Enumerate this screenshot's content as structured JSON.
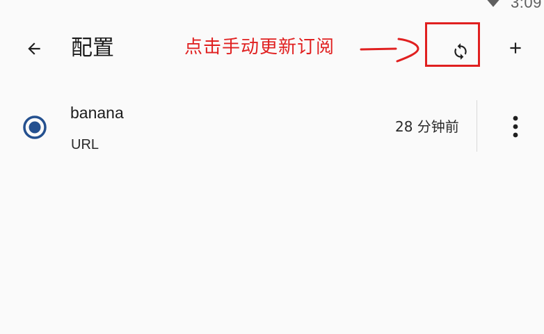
{
  "status_bar": {
    "time": "3:09",
    "icons": [
      "wifi-icon"
    ]
  },
  "app_bar": {
    "title": "配置",
    "back_icon": "arrow-back-icon",
    "refresh_icon": "sync-icon",
    "add_icon": "plus-icon"
  },
  "annotation": {
    "text": "点击手动更新订阅",
    "color": "#e02020"
  },
  "profiles": [
    {
      "name": "banana",
      "type": "URL",
      "updated": "28 分钟前",
      "selected": true,
      "menu_icon": "more-vertical-icon"
    }
  ],
  "colors": {
    "accent": "#24508f",
    "annotation": "#e02020",
    "background": "#fafafa"
  }
}
